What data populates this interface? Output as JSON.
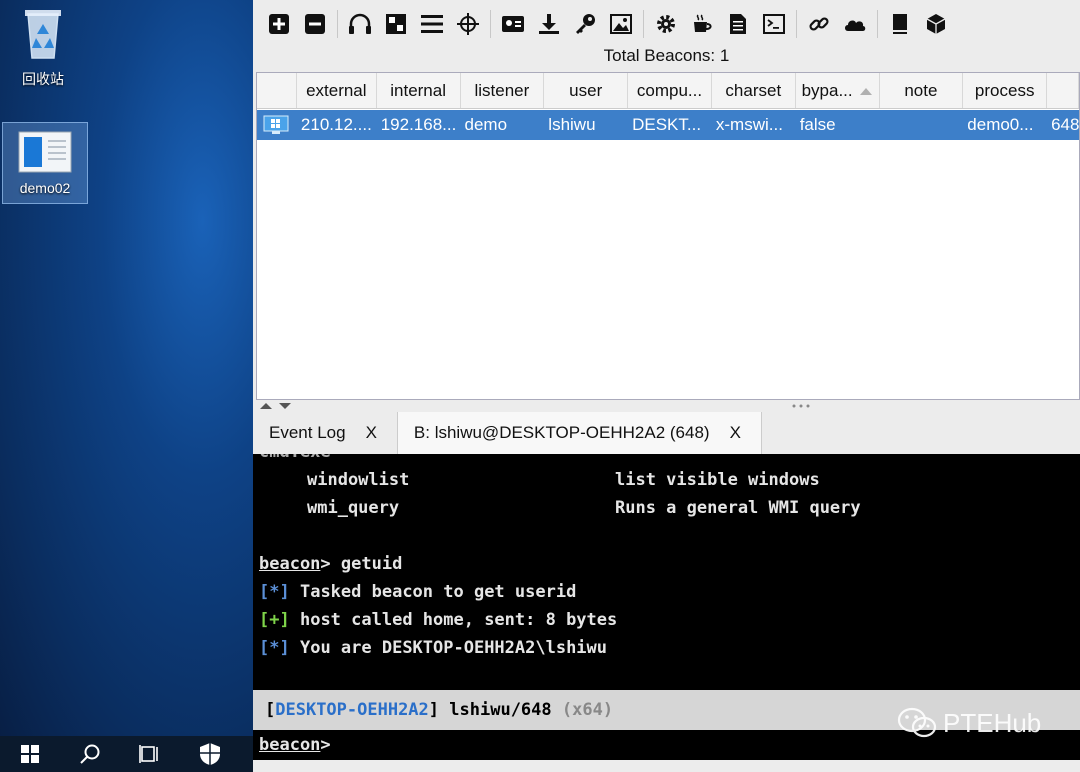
{
  "desktop": {
    "icons": [
      {
        "label": "回收站"
      },
      {
        "label": "demo02"
      }
    ]
  },
  "toolbar": {
    "total_beacons": "Total Beacons: 1"
  },
  "table": {
    "columns": [
      "external",
      "internal",
      "listener",
      "user",
      "compu...",
      "charset",
      "bypa...",
      "note",
      "process",
      ""
    ],
    "rows": [
      {
        "external": "210.12....",
        "internal": "192.168...",
        "listener": "demo",
        "user": "lshiwu",
        "computer": "DESKT...",
        "charset": "x-mswi...",
        "bypass": "false",
        "note": "",
        "process": "demo0...",
        "pid": "648"
      }
    ]
  },
  "tabs": [
    {
      "label": "Event Log",
      "close": "X"
    },
    {
      "label": "B: lshiwu@DESKTOP-OEHH2A2 (648)",
      "close": "X"
    }
  ],
  "console": {
    "partial_top": "cmd.exe",
    "lines": [
      {
        "cmd": "windowlist",
        "desc": "list visible windows"
      },
      {
        "cmd": "wmi_query",
        "desc": "Runs a general WMI query"
      }
    ],
    "prompt_word": "beacon",
    "prompt_suffix": "> getuid",
    "out1_tag": "[*]",
    "out1_text": "Tasked beacon to get userid",
    "out2_tag": "[+]",
    "out2_text": "host called home, sent: 8 bytes",
    "out3_tag": "[*]",
    "out3_text": "You are DESKTOP-OEHH2A2\\lshiwu"
  },
  "status": {
    "open": "[",
    "host": "DESKTOP-OEHH2A2",
    "close": "]",
    "user": "lshiwu/648",
    "arch": "(x64)"
  },
  "input": {
    "prompt_word": "beacon",
    "prompt_suffix": ">"
  },
  "watermark": {
    "text": "PTEHub"
  },
  "colors": {
    "selection": "#3d7fc9",
    "console_bg": "#000000",
    "host_blue": "#2a6fc9",
    "tag_blue": "#5b8fd6",
    "tag_green": "#7fd44a"
  }
}
